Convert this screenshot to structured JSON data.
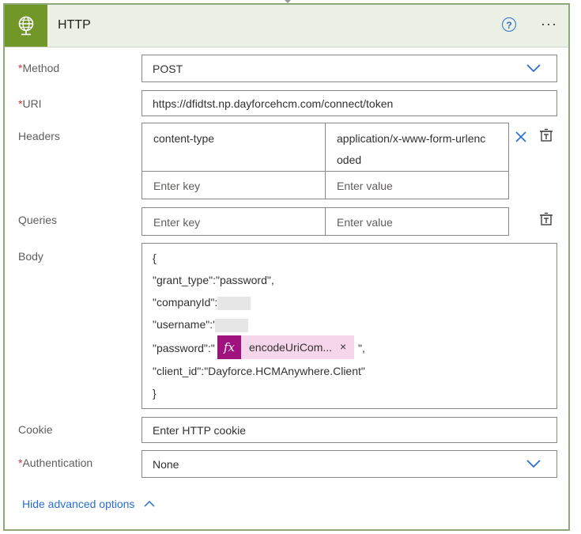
{
  "header": {
    "title": "HTTP",
    "help_icon": "?",
    "more_icon": "···"
  },
  "method": {
    "label": "Method",
    "value": "POST"
  },
  "uri": {
    "label": "URI",
    "value": "https://dfidtst.np.dayforcehcm.com/connect/token"
  },
  "headers": {
    "label": "Headers",
    "rows": [
      {
        "key": "content-type",
        "value_line1": "application/x-www-form-urlenc",
        "value_line2": "oded"
      }
    ],
    "key_placeholder": "Enter key",
    "value_placeholder": "Enter value"
  },
  "queries": {
    "label": "Queries",
    "key_placeholder": "Enter key",
    "value_placeholder": "Enter value"
  },
  "body": {
    "label": "Body",
    "line1": "{",
    "line2": "\"grant_type\":\"password\",",
    "line3": "\"companyId\":",
    "line4": "\"username\":'",
    "line5_prefix": "\"password\":\"",
    "token_label": "encodeUriCom...",
    "token_close": "×",
    "line5_suffix": "\",",
    "line6": "\"client_id\":\"Dayforce.HCMAnywhere.Client\"",
    "line7": "}"
  },
  "cookie": {
    "label": "Cookie",
    "placeholder": "Enter HTTP cookie"
  },
  "authentication": {
    "label": "Authentication",
    "value": "None"
  },
  "required_marker": "*",
  "advanced": {
    "label": "Hide advanced options"
  },
  "colors": {
    "accent": "#2b6ed1",
    "header_bg": "#eaf0e3",
    "icon_bg": "#709727",
    "token": "#a0137f"
  }
}
